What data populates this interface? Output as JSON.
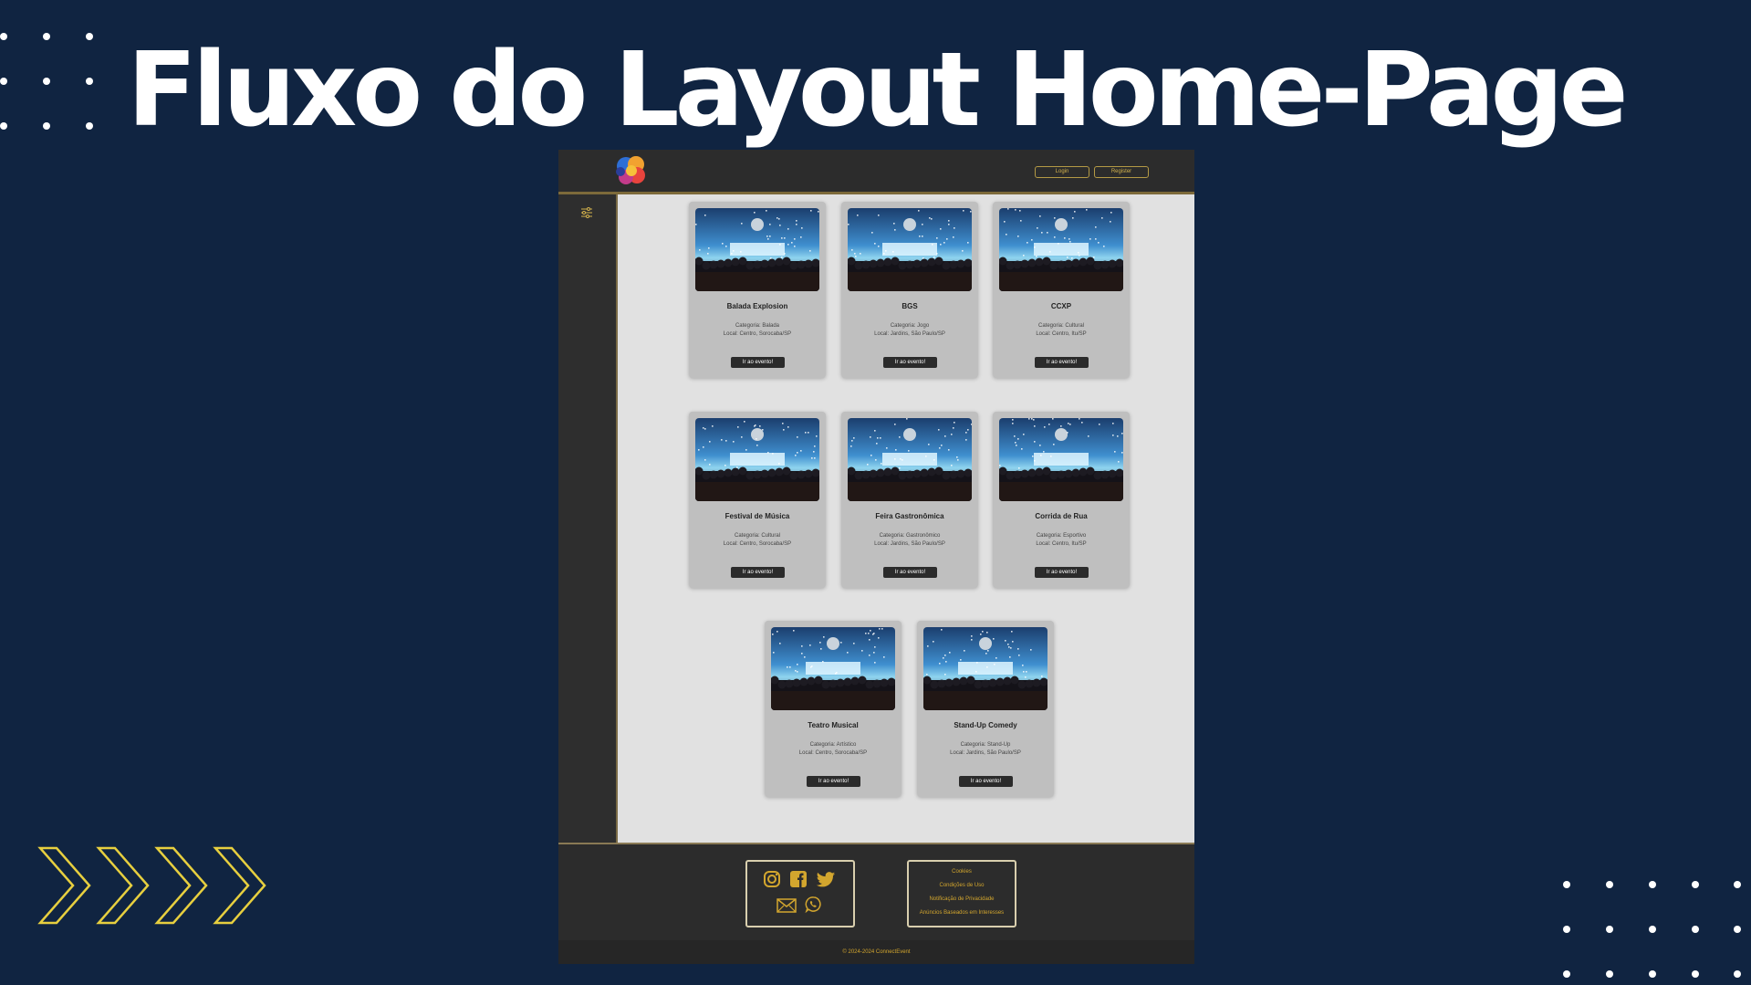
{
  "slide": {
    "title": "Fluxo do Layout Home-Page"
  },
  "header": {
    "login_label": "Login",
    "register_label": "Register"
  },
  "events": [
    {
      "title": "Balada Explosion",
      "category": "Categoria: Balada",
      "location": "Local: Centro, Sorocaba/SP",
      "button": "Ir ao evento!"
    },
    {
      "title": "BGS",
      "category": "Categoria: Jogo",
      "location": "Local: Jardins, São Paulo/SP",
      "button": "Ir ao evento!"
    },
    {
      "title": "CCXP",
      "category": "Categoria: Cultural",
      "location": "Local: Centro, Itu/SP",
      "button": "Ir ao evento!"
    },
    {
      "title": "Festival de Música",
      "category": "Categoria: Cultural",
      "location": "Local: Centro, Sorocaba/SP",
      "button": "Ir ao evento!"
    },
    {
      "title": "Feira Gastronômica",
      "category": "Categoria: Gastronômico",
      "location": "Local: Jardins, São Paulo/SP",
      "button": "Ir ao evento!"
    },
    {
      "title": "Corrida de Rua",
      "category": "Categoria: Esportivo",
      "location": "Local: Centro, Itu/SP",
      "button": "Ir ao evento!"
    },
    {
      "title": "Teatro Musical",
      "category": "Categoria: Artístico",
      "location": "Local: Centro, Sorocaba/SP",
      "button": "Ir ao evento!"
    },
    {
      "title": "Stand-Up Comedy",
      "category": "Categoria: Stand-Up",
      "location": "Local: Jardins, São Paulo/SP",
      "button": "Ir ao evento!"
    }
  ],
  "footer": {
    "links": [
      "Cookies",
      "Condições de Uso",
      "Notificação de Privacidade",
      "Anúncios Baseados em Interesses"
    ],
    "copyright": "© 2024-2024 ConnectEvent",
    "social_icons": [
      "instagram-icon",
      "facebook-icon",
      "twitter-icon",
      "mail-icon",
      "whatsapp-icon"
    ]
  },
  "colors": {
    "slide_bg": "#102441",
    "accent_gold": "#d3a62e",
    "header_bg": "#2c2c2c",
    "card_bg": "#bfbfbf",
    "content_bg": "#e1e1e1"
  }
}
